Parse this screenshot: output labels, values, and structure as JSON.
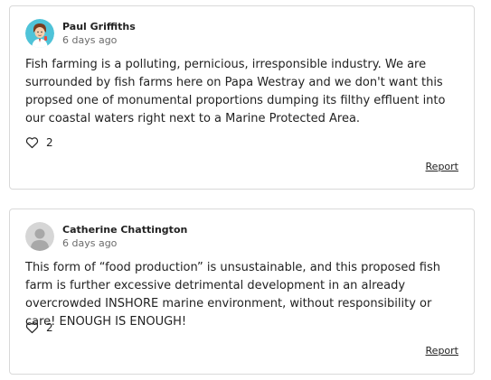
{
  "comments": [
    {
      "author": "Paul Griffiths",
      "timestamp": "6 days ago",
      "avatar_icon": "cartoon-person-avatar-icon",
      "avatar_bg": "#4fc3d8",
      "body": "Fish farming is a polluting, pernicious, irresponsible industry. We are surrounded by fish farms here on Papa Westray and we don't want this propsed one of monumental proportions dumping its filthy effluent into our coastal waters right next to a Marine Protected Area.",
      "likes": "2",
      "report_label": "Report"
    },
    {
      "author": "Catherine Chattington",
      "timestamp": "6 days ago",
      "avatar_icon": "default-user-avatar-icon",
      "avatar_bg": "#d6d6d6",
      "body": "This form of “food production” is unsustainable, and this proposed fish farm is further excessive detrimental development in an already overcrowded INSHORE marine environment, without responsibility or care! ENOUGH IS ENOUGH!",
      "likes": "2",
      "report_label": "Report"
    }
  ],
  "colors": {
    "border": "#d9d9d9",
    "text": "#222222",
    "muted": "#6b6b6b"
  }
}
